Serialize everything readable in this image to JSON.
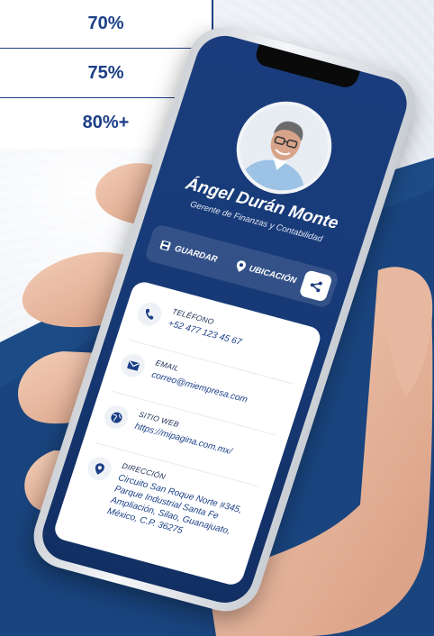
{
  "percent_table": {
    "rows": [
      "70%",
      "75%",
      "80%+"
    ]
  },
  "profile": {
    "name": "Ángel Durán Monte",
    "role": "Gerente de Finanzas y Contabilidad"
  },
  "actions": {
    "save_label": "GUARDAR",
    "location_label": "UBICACIÓN",
    "share_icon": "share-icon"
  },
  "contact": {
    "phone": {
      "label": "TELÉFONO",
      "value": "+52 477 123 45 67",
      "icon": "phone-icon"
    },
    "email": {
      "label": "EMAIL",
      "value": "correo@miempresa.com",
      "icon": "envelope-icon"
    },
    "website": {
      "label": "SITIO WEB",
      "value": "https://mipagina.com.mx/",
      "icon": "globe-icon"
    },
    "address": {
      "label": "DIRECCIÓN",
      "lines": [
        "Circuito San Roque Norte #345,",
        "Parque Industrial Santa Fe",
        "Ampliación, Silao, Guanajuato,",
        "México, C.P. 36275"
      ],
      "icon": "location-pin-icon"
    }
  },
  "colors": {
    "brand_blue": "#1b3f86",
    "screen_dark": "#122f63",
    "background_dark_blue": "#1d4b86"
  }
}
